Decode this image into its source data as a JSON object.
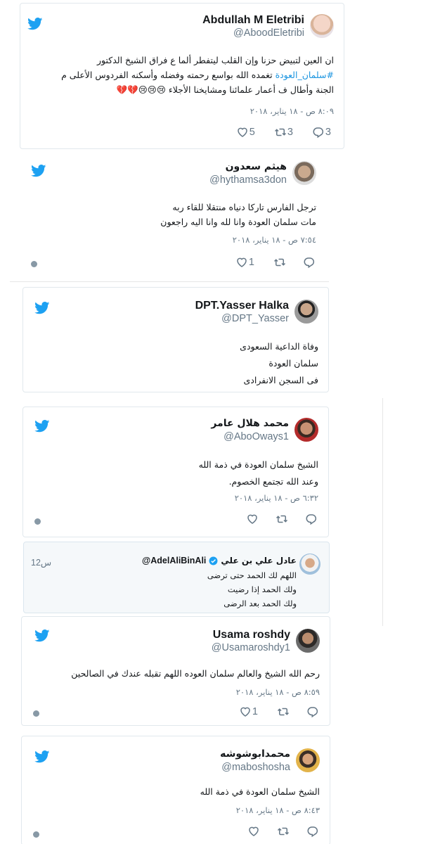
{
  "colors": {
    "twitter_blue": "#1da1f2",
    "link": "#1b95e0",
    "muted": "#657786",
    "border": "#e1e8ed"
  },
  "icons": {
    "bird": "twitter-bird-icon",
    "reply": "reply-icon",
    "retweet": "retweet-icon",
    "like": "heart-icon",
    "info": "info-icon",
    "verified": "verified-badge-icon"
  },
  "tweets": [
    {
      "name": "Abdullah M Eletribi",
      "handle": "@AboodEletribi",
      "lines": [
        "ان العين لتبيض حزنا وإن القلب ليتفطر ألما ع فراق الشيخ الدكتور",
        "سلمان_العودة تغمده الله بواسع رحمته وفضله وأسكنه الفردوس الأعلى م",
        "الجنة وأطال ف أعمار علمائنا ومشايخنا الأجلاء 😢😢😢💔💔"
      ],
      "hashtag": "#سلمان_العودة",
      "hashtag_rest": " تغمده الله بواسع رحمته وفضله وأسكنه الفردوس الأعلى م",
      "date": "٨:٠٩ ص - ١٨ يناير، ٢٠١٨",
      "replies": "3",
      "retweets": "3",
      "likes": "5"
    },
    {
      "name": "هيثم سعدون",
      "handle": "@hythamsa3don",
      "lines": [
        "ترجل الفارس تاركا دنياه منتقلا للقاء ربه",
        "مات سلمان العودة وانا لله وانا اليه راجعون"
      ],
      "date": "٧:٥٤ ص - ١٨ يناير، ٢٠١٨",
      "replies": "",
      "retweets": "",
      "likes": "1"
    },
    {
      "name": "DPT.Yasser Halka",
      "handle": "@DPT_Yasser",
      "lines": [
        "وفاة الداعية السعودى",
        "سلمان العودة",
        "فى السجن الانفرادى"
      ]
    },
    {
      "name": "محمد هلال عامر",
      "handle": "@AboOways1",
      "lines": [
        "الشيخ سلمان العودة في ذمة الله",
        "وعند الله تجتمع الخصوم."
      ],
      "date": "٦:٣٢ ص - ١٨ يناير، ٢٠١٨",
      "replies": "",
      "retweets": "",
      "likes": ""
    },
    {
      "name": "Usama roshdy",
      "handle": "@Usamaroshdy1",
      "lines": [
        "رحم الله الشيخ والعالم سلمان العوده اللهم تقبله عندك في الصالحين"
      ],
      "date": "٨:٥٩ ص - ١٨ يناير، ٢٠١٨",
      "replies": "",
      "retweets": "",
      "likes": "1"
    },
    {
      "name": "محمدابوشوشه",
      "handle": "@maboshosha",
      "lines": [
        "الشيخ سلمان العودة في ذمة الله"
      ],
      "date": "٨:٤٣ ص - ١٨ يناير، ٢٠١٨",
      "replies": "",
      "retweets": "",
      "likes": ""
    }
  ],
  "quote": {
    "name": "عادل علي بن علي",
    "handle": "@AdelAliBinAli",
    "time": "12س",
    "lines": [
      "اللهم لك الحمد حتى ترضى",
      "ولك الحمد إذا رضيت",
      "ولك الحمد بعد الرضى"
    ]
  }
}
